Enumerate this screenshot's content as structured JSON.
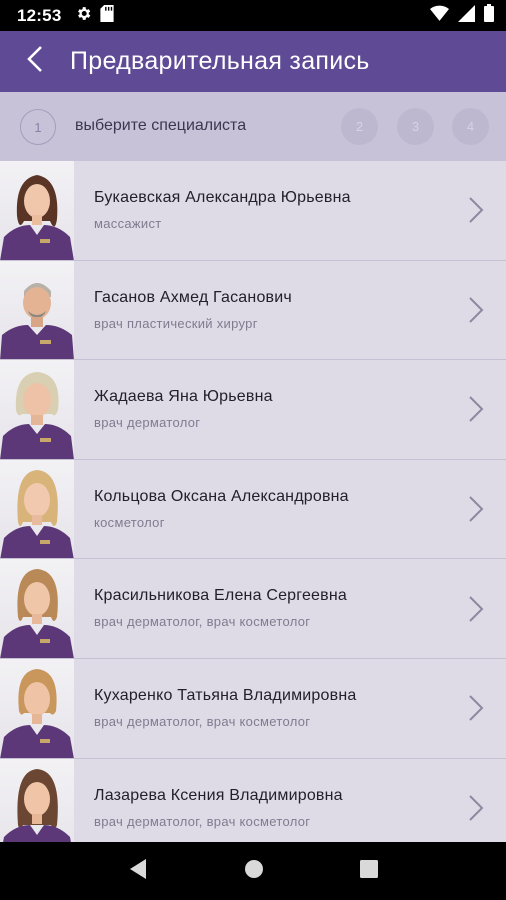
{
  "status_bar": {
    "time": "12:53",
    "icons": [
      "gear-icon",
      "sd-card-icon",
      "wifi-icon",
      "signal-icon",
      "battery-icon"
    ]
  },
  "header": {
    "title": "Предварительная запись",
    "back_icon": "chevron-left-icon",
    "color": "#5f4a96"
  },
  "stepper": {
    "current_step": "1",
    "current_label": "выберите специалиста",
    "steps": [
      "2",
      "3",
      "4"
    ]
  },
  "specialists": [
    {
      "name": "Букаевская Александра Юрьевна",
      "role": "массажист"
    },
    {
      "name": "Гасанов Ахмед Гасанович",
      "role": "врач пластический хирург"
    },
    {
      "name": "Жадаева Яна Юрьевна",
      "role": "врач дерматолог"
    },
    {
      "name": "Кольцова Оксана Александровна",
      "role": "косметолог"
    },
    {
      "name": "Красильникова Елена Сергеевна",
      "role": "врач дерматолог, врач косметолог"
    },
    {
      "name": "Кухаренко Татьяна Владимировна",
      "role": "врач дерматолог, врач косметолог"
    },
    {
      "name": "Лазарева Ксения Владимировна",
      "role": "врач дерматолог, врач косметолог"
    }
  ],
  "nav_bar": {
    "icons": [
      "back-triangle-icon",
      "home-circle-icon",
      "recents-square-icon"
    ]
  }
}
